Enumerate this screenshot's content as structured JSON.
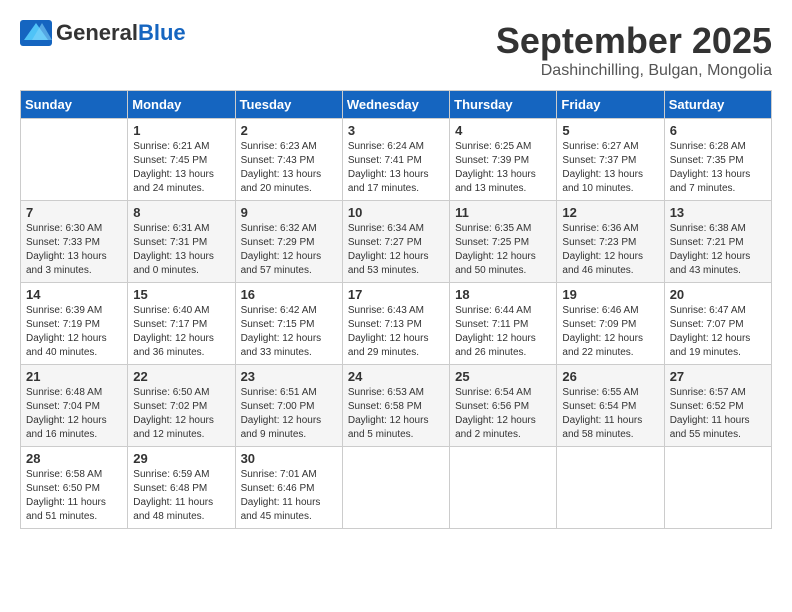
{
  "header": {
    "logo_general": "General",
    "logo_blue": "Blue",
    "month_title": "September 2025",
    "location": "Dashinchilling, Bulgan, Mongolia"
  },
  "days_of_week": [
    "Sunday",
    "Monday",
    "Tuesday",
    "Wednesday",
    "Thursday",
    "Friday",
    "Saturday"
  ],
  "weeks": [
    [
      {
        "day": "",
        "info": ""
      },
      {
        "day": "1",
        "info": "Sunrise: 6:21 AM\nSunset: 7:45 PM\nDaylight: 13 hours\nand 24 minutes."
      },
      {
        "day": "2",
        "info": "Sunrise: 6:23 AM\nSunset: 7:43 PM\nDaylight: 13 hours\nand 20 minutes."
      },
      {
        "day": "3",
        "info": "Sunrise: 6:24 AM\nSunset: 7:41 PM\nDaylight: 13 hours\nand 17 minutes."
      },
      {
        "day": "4",
        "info": "Sunrise: 6:25 AM\nSunset: 7:39 PM\nDaylight: 13 hours\nand 13 minutes."
      },
      {
        "day": "5",
        "info": "Sunrise: 6:27 AM\nSunset: 7:37 PM\nDaylight: 13 hours\nand 10 minutes."
      },
      {
        "day": "6",
        "info": "Sunrise: 6:28 AM\nSunset: 7:35 PM\nDaylight: 13 hours\nand 7 minutes."
      }
    ],
    [
      {
        "day": "7",
        "info": "Sunrise: 6:30 AM\nSunset: 7:33 PM\nDaylight: 13 hours\nand 3 minutes."
      },
      {
        "day": "8",
        "info": "Sunrise: 6:31 AM\nSunset: 7:31 PM\nDaylight: 13 hours\nand 0 minutes."
      },
      {
        "day": "9",
        "info": "Sunrise: 6:32 AM\nSunset: 7:29 PM\nDaylight: 12 hours\nand 57 minutes."
      },
      {
        "day": "10",
        "info": "Sunrise: 6:34 AM\nSunset: 7:27 PM\nDaylight: 12 hours\nand 53 minutes."
      },
      {
        "day": "11",
        "info": "Sunrise: 6:35 AM\nSunset: 7:25 PM\nDaylight: 12 hours\nand 50 minutes."
      },
      {
        "day": "12",
        "info": "Sunrise: 6:36 AM\nSunset: 7:23 PM\nDaylight: 12 hours\nand 46 minutes."
      },
      {
        "day": "13",
        "info": "Sunrise: 6:38 AM\nSunset: 7:21 PM\nDaylight: 12 hours\nand 43 minutes."
      }
    ],
    [
      {
        "day": "14",
        "info": "Sunrise: 6:39 AM\nSunset: 7:19 PM\nDaylight: 12 hours\nand 40 minutes."
      },
      {
        "day": "15",
        "info": "Sunrise: 6:40 AM\nSunset: 7:17 PM\nDaylight: 12 hours\nand 36 minutes."
      },
      {
        "day": "16",
        "info": "Sunrise: 6:42 AM\nSunset: 7:15 PM\nDaylight: 12 hours\nand 33 minutes."
      },
      {
        "day": "17",
        "info": "Sunrise: 6:43 AM\nSunset: 7:13 PM\nDaylight: 12 hours\nand 29 minutes."
      },
      {
        "day": "18",
        "info": "Sunrise: 6:44 AM\nSunset: 7:11 PM\nDaylight: 12 hours\nand 26 minutes."
      },
      {
        "day": "19",
        "info": "Sunrise: 6:46 AM\nSunset: 7:09 PM\nDaylight: 12 hours\nand 22 minutes."
      },
      {
        "day": "20",
        "info": "Sunrise: 6:47 AM\nSunset: 7:07 PM\nDaylight: 12 hours\nand 19 minutes."
      }
    ],
    [
      {
        "day": "21",
        "info": "Sunrise: 6:48 AM\nSunset: 7:04 PM\nDaylight: 12 hours\nand 16 minutes."
      },
      {
        "day": "22",
        "info": "Sunrise: 6:50 AM\nSunset: 7:02 PM\nDaylight: 12 hours\nand 12 minutes."
      },
      {
        "day": "23",
        "info": "Sunrise: 6:51 AM\nSunset: 7:00 PM\nDaylight: 12 hours\nand 9 minutes."
      },
      {
        "day": "24",
        "info": "Sunrise: 6:53 AM\nSunset: 6:58 PM\nDaylight: 12 hours\nand 5 minutes."
      },
      {
        "day": "25",
        "info": "Sunrise: 6:54 AM\nSunset: 6:56 PM\nDaylight: 12 hours\nand 2 minutes."
      },
      {
        "day": "26",
        "info": "Sunrise: 6:55 AM\nSunset: 6:54 PM\nDaylight: 11 hours\nand 58 minutes."
      },
      {
        "day": "27",
        "info": "Sunrise: 6:57 AM\nSunset: 6:52 PM\nDaylight: 11 hours\nand 55 minutes."
      }
    ],
    [
      {
        "day": "28",
        "info": "Sunrise: 6:58 AM\nSunset: 6:50 PM\nDaylight: 11 hours\nand 51 minutes."
      },
      {
        "day": "29",
        "info": "Sunrise: 6:59 AM\nSunset: 6:48 PM\nDaylight: 11 hours\nand 48 minutes."
      },
      {
        "day": "30",
        "info": "Sunrise: 7:01 AM\nSunset: 6:46 PM\nDaylight: 11 hours\nand 45 minutes."
      },
      {
        "day": "",
        "info": ""
      },
      {
        "day": "",
        "info": ""
      },
      {
        "day": "",
        "info": ""
      },
      {
        "day": "",
        "info": ""
      }
    ]
  ]
}
